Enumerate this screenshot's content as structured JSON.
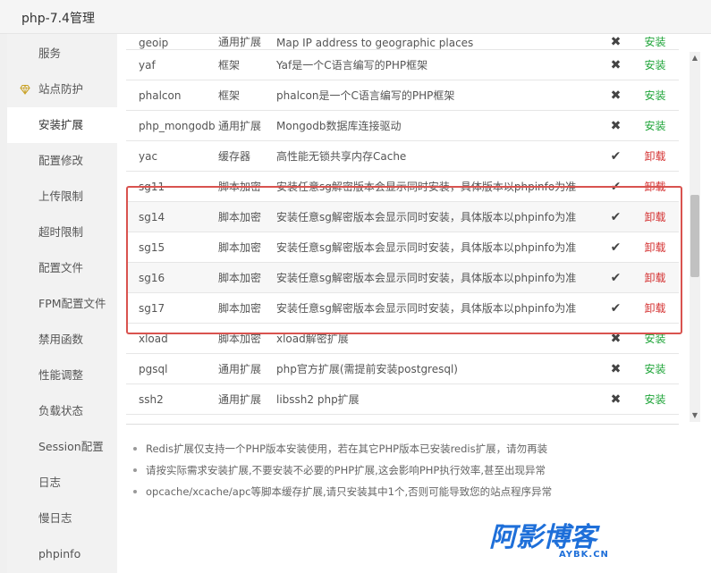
{
  "window": {
    "title": "php-7.4管理"
  },
  "sidebar": {
    "items": [
      {
        "label": "服务"
      },
      {
        "label": "站点防护"
      },
      {
        "label": "安装扩展"
      },
      {
        "label": "配置修改"
      },
      {
        "label": "上传限制"
      },
      {
        "label": "超时限制"
      },
      {
        "label": "配置文件"
      },
      {
        "label": "FPM配置文件"
      },
      {
        "label": "禁用函数"
      },
      {
        "label": "性能调整"
      },
      {
        "label": "负载状态"
      },
      {
        "label": "Session配置"
      },
      {
        "label": "日志"
      },
      {
        "label": "慢日志"
      },
      {
        "label": "phpinfo"
      }
    ],
    "active_index": 2
  },
  "extensions": {
    "rows": [
      {
        "name": "geoip",
        "type": "通用扩展",
        "desc": "Map IP address to geographic places",
        "status": "✖",
        "action": "安装"
      },
      {
        "name": "yaf",
        "type": "框架",
        "desc": "Yaf是一个C语言编写的PHP框架",
        "status": "✖",
        "action": "安装"
      },
      {
        "name": "phalcon",
        "type": "框架",
        "desc": "phalcon是一个C语言编写的PHP框架",
        "status": "✖",
        "action": "安装"
      },
      {
        "name": "php_mongodb",
        "type": "通用扩展",
        "desc": "Mongodb数据库连接驱动",
        "status": "✖",
        "action": "安装"
      },
      {
        "name": "yac",
        "type": "缓存器",
        "desc": "高性能无锁共享内存Cache",
        "status": "✔",
        "action": "卸载"
      },
      {
        "name": "sg11",
        "type": "脚本加密",
        "desc": "安装任意sg解密版本会显示同时安装，具体版本以phpinfo为准",
        "status": "✔",
        "action": "卸载"
      },
      {
        "name": "sg14",
        "type": "脚本加密",
        "desc": "安装任意sg解密版本会显示同时安装，具体版本以phpinfo为准",
        "status": "✔",
        "action": "卸载"
      },
      {
        "name": "sg15",
        "type": "脚本加密",
        "desc": "安装任意sg解密版本会显示同时安装，具体版本以phpinfo为准",
        "status": "✔",
        "action": "卸载"
      },
      {
        "name": "sg16",
        "type": "脚本加密",
        "desc": "安装任意sg解密版本会显示同时安装，具体版本以phpinfo为准",
        "status": "✔",
        "action": "卸载"
      },
      {
        "name": "sg17",
        "type": "脚本加密",
        "desc": "安装任意sg解密版本会显示同时安装，具体版本以phpinfo为准",
        "status": "✔",
        "action": "卸载"
      },
      {
        "name": "xload",
        "type": "脚本加密",
        "desc": "xload解密扩展",
        "status": "✖",
        "action": "安装"
      },
      {
        "name": "pgsql",
        "type": "通用扩展",
        "desc": "php官方扩展(需提前安装postgresql)",
        "status": "✖",
        "action": "安装"
      },
      {
        "name": "ssh2",
        "type": "通用扩展",
        "desc": "libssh2 php扩展",
        "status": "✖",
        "action": "安装"
      }
    ]
  },
  "notes": [
    "Redis扩展仅支持一个PHP版本安装使用，若在其它PHP版本已安装redis扩展，请勿再装",
    "请按实际需求安装扩展,不要安装不必要的PHP扩展,这会影响PHP执行效率,甚至出现异常",
    "opcache/xcache/apc等脚本缓存扩展,请只安装其中1个,否则可能导致您的站点程序异常"
  ],
  "watermark": {
    "main": "阿影博客",
    "sub": "AYBK.CN"
  },
  "colors": {
    "install": "#20a53a",
    "uninstall": "#d43030",
    "highlight": "#d9534f",
    "watermark": "#1e6fd9"
  }
}
